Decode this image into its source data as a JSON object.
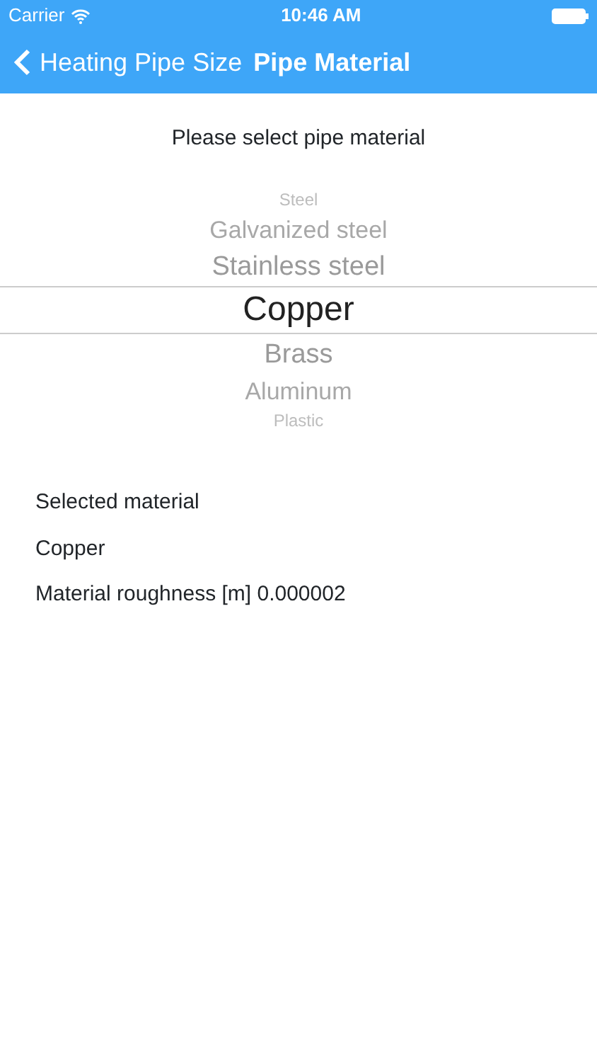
{
  "status_bar": {
    "carrier": "Carrier",
    "time": "10:46 AM"
  },
  "nav": {
    "back_label": "Heating Pipe Size",
    "title": "Pipe Material"
  },
  "prompt": "Please select pipe material",
  "picker": [
    {
      "label": "Steel",
      "selected": false
    },
    {
      "label": "Galvanized steel",
      "selected": false
    },
    {
      "label": "Stainless steel",
      "selected": false
    },
    {
      "label": "Copper",
      "selected": true
    },
    {
      "label": "Brass",
      "selected": false
    },
    {
      "label": "Aluminum",
      "selected": false
    },
    {
      "label": "Plastic",
      "selected": false
    }
  ],
  "info": [
    "Selected material",
    "Copper",
    "Material roughness [m]  0.000002"
  ]
}
